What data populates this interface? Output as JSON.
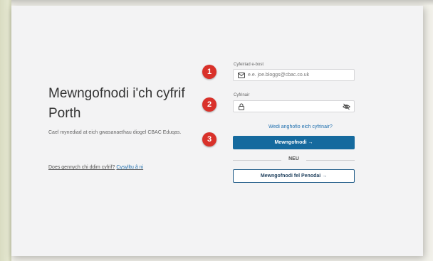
{
  "login": {
    "title": "Mewngofnodi i'ch cyfrif Porth",
    "subtitle": "Cael mynediad at eich gwasanaethau diogel CBAC Eduqas.",
    "no_account_text": "Does gennych chi ddim cyfrif?",
    "signup_link": "Cysylltu â ni"
  },
  "form": {
    "email_label": "Cyfeiriad e-bost",
    "email_placeholder": "e.e. joe.bloggs@cbac.co.uk",
    "password_label": "Cyfrinair",
    "password_value": "",
    "forgot_link": "Wedi anghofio eich cyfrinair?",
    "login_button": "Mewngofnodi →",
    "or_text": "NEU",
    "appointee_button": "Mewngofnodi fel Penodai →"
  },
  "annotations": {
    "badges": [
      "1",
      "2",
      "3"
    ],
    "badge_color": "#d9312a"
  },
  "colors": {
    "primary": "#156a9e",
    "link": "#1f6fae"
  },
  "icons": {
    "email": "envelope-icon",
    "password": "lock-icon",
    "toggle": "eye-slash-icon"
  }
}
